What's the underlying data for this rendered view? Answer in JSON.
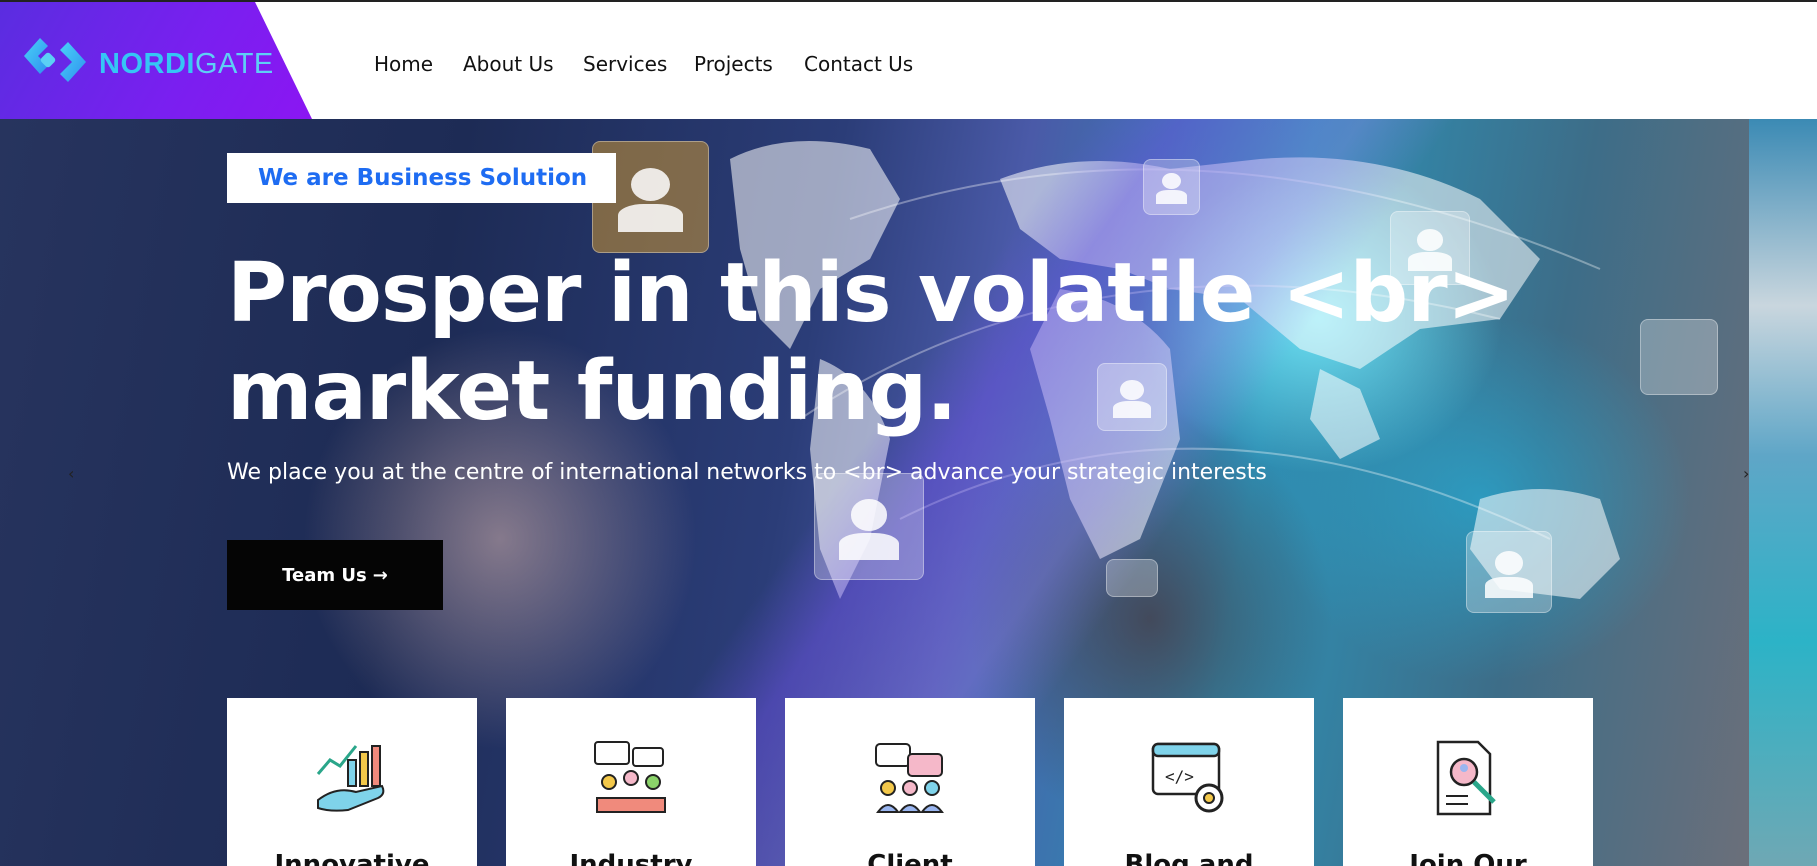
{
  "brand": {
    "name_bold": "NORDI",
    "name_light": "GATE"
  },
  "nav": {
    "items": [
      "Home",
      "About Us",
      "Services",
      "Projects",
      "Contact Us"
    ]
  },
  "hero": {
    "badge": "We are Business Solution",
    "title_line1": "Prosper in this volatile <br>",
    "title_line2": "market funding.",
    "subtitle": "We place you at the centre of international networks to <br> advance your strategic interests",
    "cta_label": "Team Us",
    "cta_arrow": "→",
    "prev_arrow": "‹",
    "next_arrow": "›"
  },
  "features": [
    {
      "label": "Innovative",
      "icon": "growth-chart-hand-icon"
    },
    {
      "label": "Industry",
      "icon": "team-meeting-icon"
    },
    {
      "label": "Client",
      "icon": "client-chat-group-icon"
    },
    {
      "label": "Blog and",
      "icon": "web-code-settings-icon"
    },
    {
      "label": "Join Our",
      "icon": "resume-search-icon"
    }
  ],
  "colors": {
    "brand_gradient_start": "#5a2de0",
    "brand_gradient_end": "#8b16f2",
    "badge_text": "#1e6cf2",
    "logo_text": "#35c6f5"
  }
}
